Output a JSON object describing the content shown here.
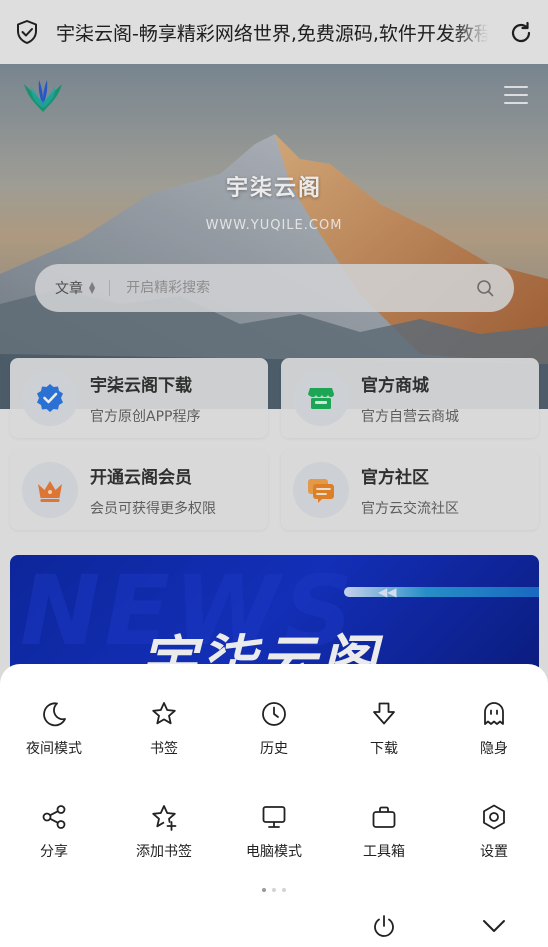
{
  "browser": {
    "page_title": "宇柒云阁-畅享精彩网络世界,免费源码,软件开发教程"
  },
  "hero": {
    "site_name": "宇柒云阁",
    "site_url": "WWW.YUQILE.COM",
    "search": {
      "category": "文章",
      "placeholder": "开启精彩搜索"
    }
  },
  "cards": [
    {
      "title": "宇柒云阁下载",
      "subtitle": "官方原创APP程序",
      "icon": "verified-badge-icon",
      "color": "#2f7be5"
    },
    {
      "title": "官方商城",
      "subtitle": "官方自营云商城",
      "icon": "store-icon",
      "color": "#1fb35c"
    },
    {
      "title": "开通云阁会员",
      "subtitle": "会员可获得更多权限",
      "icon": "crown-icon",
      "color": "#f0813a"
    },
    {
      "title": "官方社区",
      "subtitle": "官方云交流社区",
      "icon": "chat-bubbles-icon",
      "color": "#f08a2a"
    }
  ],
  "banner": {
    "bg_text": "NEWS",
    "title": "宇柒云阁"
  },
  "menu": {
    "items": [
      {
        "label": "夜间模式",
        "icon": "moon-icon"
      },
      {
        "label": "书签",
        "icon": "star-icon"
      },
      {
        "label": "历史",
        "icon": "clock-icon"
      },
      {
        "label": "下载",
        "icon": "download-icon"
      },
      {
        "label": "隐身",
        "icon": "ghost-icon"
      },
      {
        "label": "分享",
        "icon": "share-icon"
      },
      {
        "label": "添加书签",
        "icon": "star-add-icon"
      },
      {
        "label": "电脑模式",
        "icon": "monitor-icon"
      },
      {
        "label": "工具箱",
        "icon": "toolbox-icon"
      },
      {
        "label": "设置",
        "icon": "settings-icon"
      }
    ],
    "page_count": 3,
    "active_page": 1
  },
  "colors": {
    "accent": "#2f7be5",
    "banner_blue": "#1533c7"
  }
}
